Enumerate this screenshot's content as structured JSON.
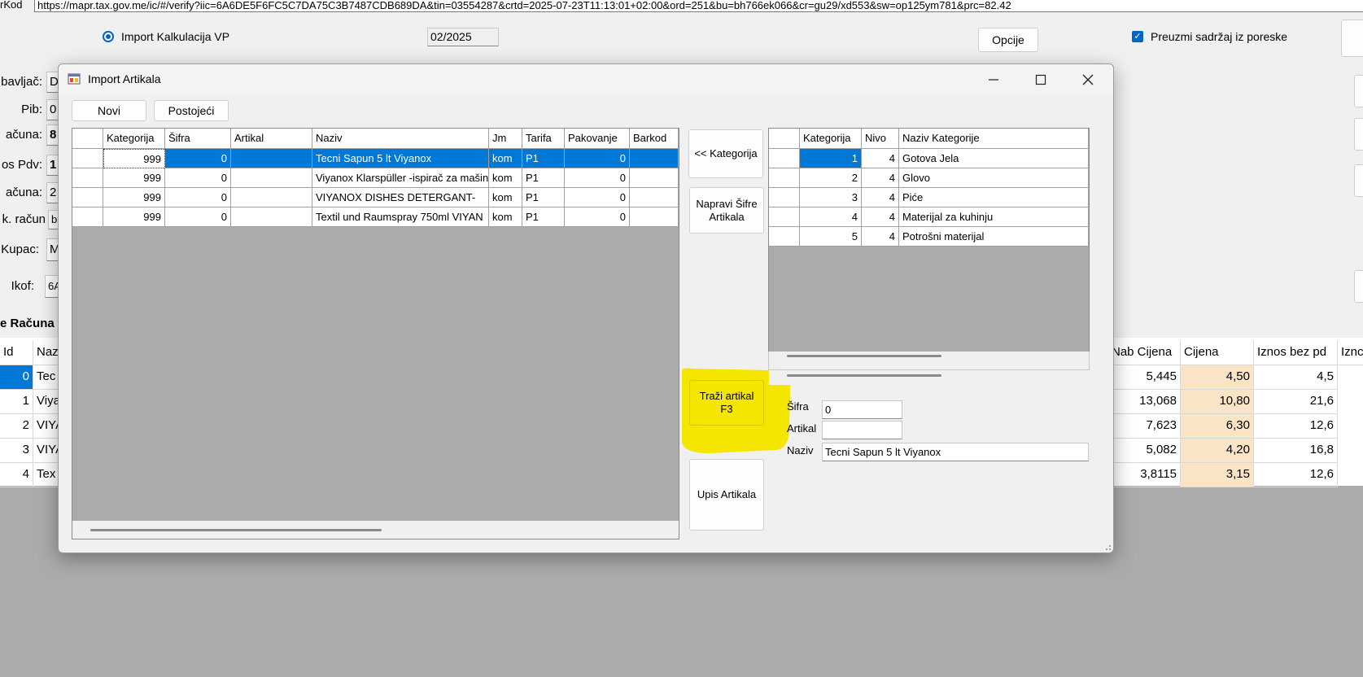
{
  "background": {
    "url_label": "rKod",
    "url_value": "https://mapr.tax.gov.me/ic/#/verify?iic=6A6DE5F6FC5C7DA75C3B7487CDB689DA&tin=03554287&crtd=2025-07-23T11:13:01+02:00&ord=251&bu=bh766ek066&cr=gu29/xd553&sw=op125ym781&prc=82.42",
    "radio_label": "Import Kalkulacija VP",
    "period_value": "02/2025",
    "options_button": "Opcije",
    "checkbox_label": "Preuzmi sadržaj iz poreske",
    "side_labels": [
      {
        "label": "bavljač:",
        "value": "D"
      },
      {
        "label": "Pib:",
        "value": "0"
      },
      {
        "label": "ačuna:",
        "value": "8"
      },
      {
        "label": "os Pdv:",
        "value": "1"
      },
      {
        "label": "ačuna:",
        "value": "2"
      },
      {
        "label": "k. račun",
        "value": "b"
      },
      {
        "label": "Kupac:",
        "value": "M"
      },
      {
        "label": "Ikof:",
        "value": "6A"
      }
    ],
    "section_title": "e Računa",
    "table": {
      "left_headers": [
        "Id",
        "Naz"
      ],
      "right_headers": [
        "Nab Cijena",
        "Cijena",
        "Iznos bez pd",
        "Iznc"
      ],
      "rows": [
        {
          "id": "0",
          "naz": "Tec",
          "nab": "5,445",
          "cijena": "4,50",
          "iznos": "4,5"
        },
        {
          "id": "1",
          "naz": "Viya",
          "nab": "13,068",
          "cijena": "10,80",
          "iznos": "21,6"
        },
        {
          "id": "2",
          "naz": "VIYA",
          "nab": "7,623",
          "cijena": "6,30",
          "iznos": "12,6"
        },
        {
          "id": "3",
          "naz": "VIYA",
          "nab": "5,082",
          "cijena": "4,20",
          "iznos": "16,8"
        },
        {
          "id": "4",
          "naz": "Tex",
          "nab": "3,8115",
          "cijena": "3,15",
          "iznos": "12,6"
        }
      ]
    }
  },
  "dialog": {
    "title": "Import Artikala",
    "toolbar": {
      "novi": "Novi",
      "postojeci": "Postojeći"
    },
    "articles_grid": {
      "headers": [
        "Kategorija",
        "Šifra",
        "Artikal",
        "Naziv",
        "Jm",
        "Tarifa",
        "Pakovanje",
        "Barkod"
      ],
      "rows": [
        {
          "kategorija": "999",
          "sifra": "0",
          "artikal": "",
          "naziv": "Tecni Sapun 5 lt Viyanox",
          "jm": "kom",
          "tarifa": "P1",
          "pakovanje": "0",
          "barkod": ""
        },
        {
          "kategorija": "999",
          "sifra": "0",
          "artikal": "",
          "naziv": "Viyanox Klarspüller -ispirač za mašin",
          "jm": "kom",
          "tarifa": "P1",
          "pakovanje": "0",
          "barkod": ""
        },
        {
          "kategorija": "999",
          "sifra": "0",
          "artikal": "",
          "naziv": "VIYANOX DISHES DETERGANT- ",
          "jm": "kom",
          "tarifa": "P1",
          "pakovanje": "0",
          "barkod": ""
        },
        {
          "kategorija": "999",
          "sifra": "0",
          "artikal": "",
          "naziv": "Textil und Raumspray 750ml VIYAN",
          "jm": "kom",
          "tarifa": "P1",
          "pakovanje": "0",
          "barkod": ""
        }
      ]
    },
    "buttons": {
      "kategorija": "<< Kategorija",
      "napravi": "Napravi Šifre Artikala",
      "trazi_line1": "Traži artikal",
      "trazi_line2": "F3",
      "upis": "Upis Artikala"
    },
    "categories_grid": {
      "headers": [
        "Kategorija",
        "Nivo",
        "Naziv Kategorije"
      ],
      "rows": [
        {
          "kategorija": "1",
          "nivo": "4",
          "naziv": "Gotova Jela"
        },
        {
          "kategorija": "2",
          "nivo": "4",
          "naziv": "Glovo"
        },
        {
          "kategorija": "3",
          "nivo": "4",
          "naziv": "Piće"
        },
        {
          "kategorija": "4",
          "nivo": "4",
          "naziv": "Materijal za kuhinju"
        },
        {
          "kategorija": "5",
          "nivo": "4",
          "naziv": "Potrošni materijal"
        }
      ]
    },
    "form": {
      "sifra_label": "Šifra",
      "sifra_value": "0",
      "artikal_label": "Artikal",
      "artikal_value": "",
      "naziv_label": "Naziv",
      "naziv_value": "Tecni Sapun 5 lt Viyanox"
    }
  },
  "colors": {
    "selection": "#0078d7",
    "highlight": "#f5e600",
    "price_cell": "#f9e4c6"
  }
}
